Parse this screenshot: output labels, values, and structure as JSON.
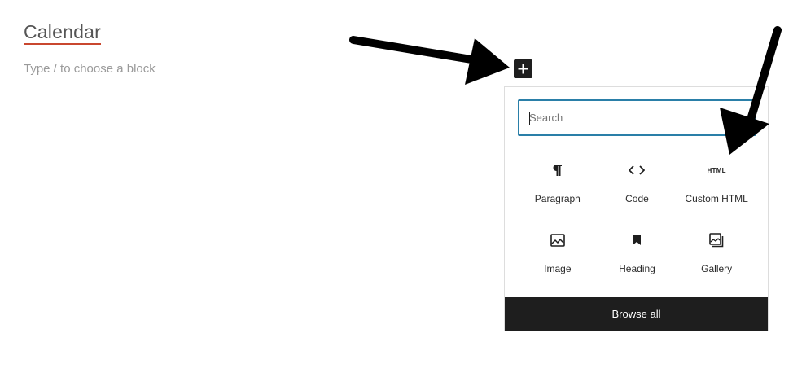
{
  "editor": {
    "post_title": "Calendar",
    "block_placeholder": "Type / to choose a block"
  },
  "inserter": {
    "toggle_icon": "plus-icon",
    "search": {
      "placeholder": "Search",
      "value": ""
    },
    "blocks": [
      {
        "label": "Paragraph",
        "icon": "paragraph-icon"
      },
      {
        "label": "Code",
        "icon": "code-icon"
      },
      {
        "label": "Custom HTML",
        "icon": "html-icon",
        "glyph": "HTML"
      },
      {
        "label": "Image",
        "icon": "image-icon"
      },
      {
        "label": "Heading",
        "icon": "bookmark-icon"
      },
      {
        "label": "Gallery",
        "icon": "gallery-icon"
      }
    ],
    "browse_all_label": "Browse all"
  },
  "annotations": {
    "arrow_color": "#000000"
  }
}
